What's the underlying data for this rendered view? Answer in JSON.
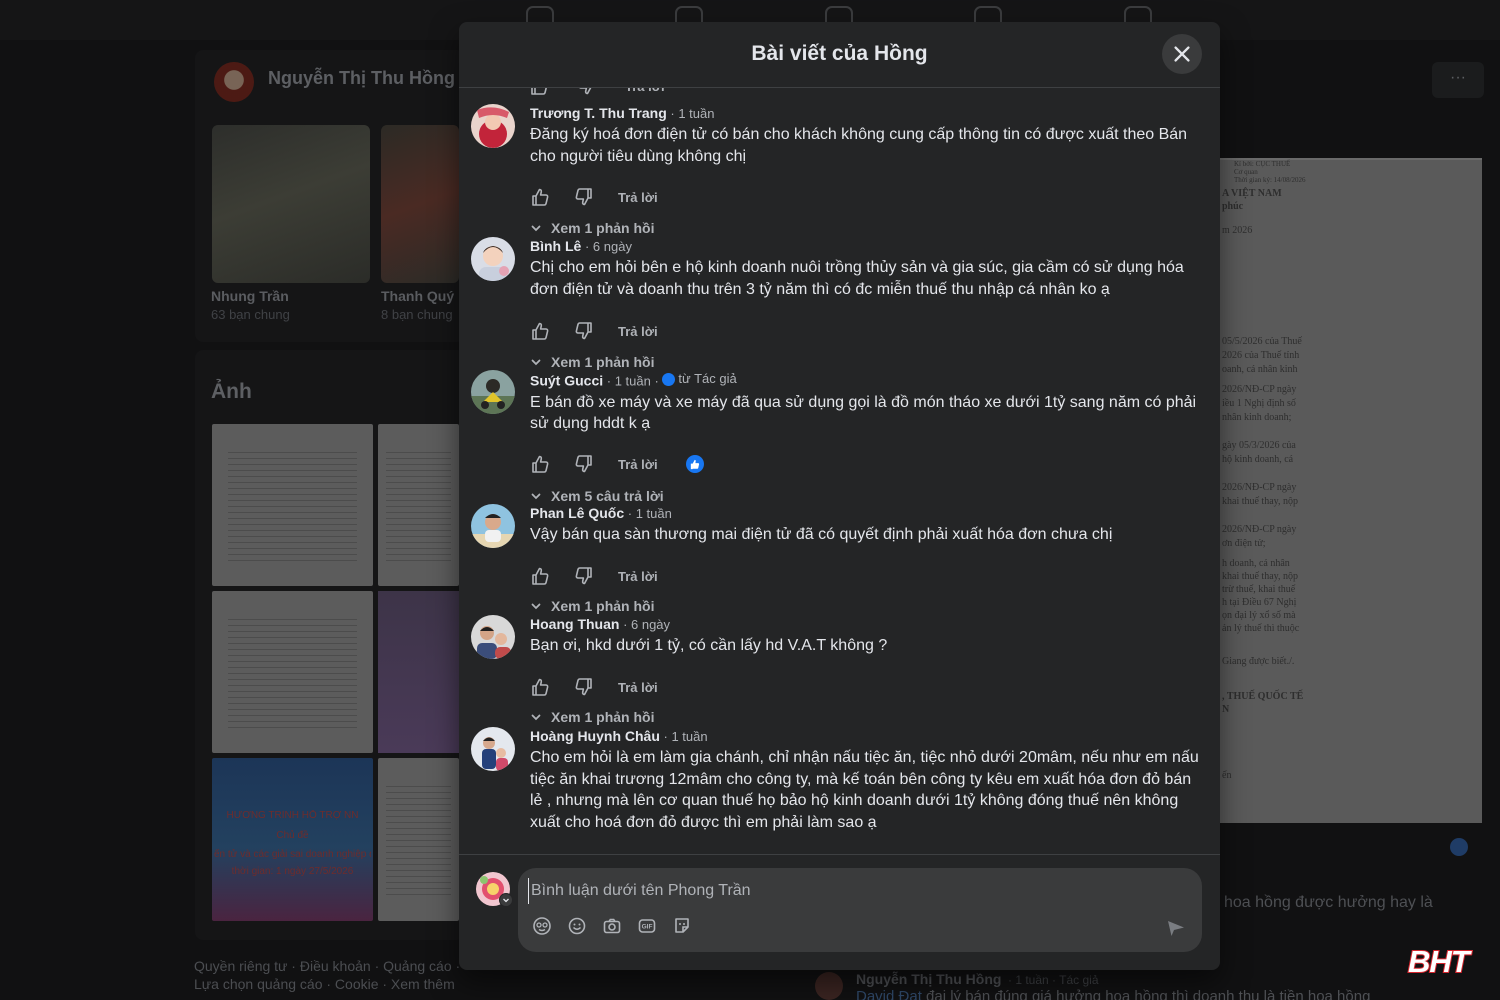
{
  "background": {
    "profile_name": "Nguyễn Thị Thu Hồng",
    "more_label": "···",
    "friends": [
      {
        "name": "Nhung Trần",
        "mutual": "63 bạn chung"
      },
      {
        "name": "Thanh Quý",
        "mutual": "8 bạn chung"
      }
    ],
    "photos_heading": "Ảnh",
    "banner_lines": [
      "HƯƠNG TRÌNH HỖ TRỢ NN",
      "Chủ đề",
      "ển tử và các giải sai doanh nghiệp đ",
      "thời gian: 1 ngày 27/5/2026"
    ],
    "right_doc_lines": [
      "Kí bởi: CỤC THUẾ",
      "Cơ quan",
      "Thời gian ký: 14/08/2026",
      "A VIỆT NAM",
      "phúc",
      "m 2026",
      "05/5/2026 của Thuế",
      "2026 của Thuế tỉnh",
      "oanh, cá nhân kinh",
      "2026/NĐ-CP ngày",
      "iều 1 Nghị định số",
      "nhân kinh doanh;",
      "gày 05/3/2026 của",
      "hộ kinh doanh, cá",
      "2026/NĐ-CP ngày",
      "khai thuế thay, nộp",
      "2026/NĐ-CP ngày",
      "ơn điện tử;",
      "h doanh, cá nhân",
      "khai thuế thay, nộp",
      "trừ thuế, khai thuế",
      "h tại Điều 67 Nghị",
      "ọn đại lý xổ số mà",
      "ản lý thuế thì thuộc",
      "Giang được biết./.",
      ", THUẾ QUỐC TẾ",
      "N",
      "ến"
    ],
    "right_text": "hoa hồng được hưởng hay là",
    "footer": "Quyền riêng tư · Điều khoản · Quảng cáo · Lựa chọn quảng cáo · Cookie · Xem thêm",
    "bottom_comment": {
      "name": "Nguyễn Thị Thu Hồng",
      "meta": "· 1 tuần · Tác giả",
      "link": "David Đạt",
      "text": " đại lý bán đúng giá hưởng hoa hồng thì doanh thu là tiền hoa hồng"
    }
  },
  "modal": {
    "title": "Bài viết của Hồng",
    "close_icon": "close-icon"
  },
  "labels": {
    "reply": "Trả lời"
  },
  "comments": [
    {
      "name": "Trương T. Thu Trang",
      "time": "· 1 tuần",
      "text": "Đăng ký hoá đơn điện tử có bán cho khách không cung cấp thông tin có được xuất theo Bán cho người tiêu dùng không chị",
      "view_replies": "Xem 1 phản hồi"
    },
    {
      "name": "Bình Lê",
      "time": "· 6 ngày",
      "text": "Chị cho em hỏi bên e hộ kinh doanh nuôi trồng thủy sản và gia súc, gia cầm có sử dụng hóa đơn điện tử và doanh thu trên 3 tỷ năm thì có đc miễn thuế thu nhập cá nhân ko ạ",
      "view_replies": "Xem 1 phản hồi"
    },
    {
      "name": "Suýt Gucci",
      "time": "· 1 tuần ·",
      "author_badge": "từ Tác giả",
      "text": "E bán đồ xe máy và xe máy đã qua sử dụng gọi là đồ món tháo xe dưới 1tỷ sang năm có phải sử dụng hddt k ạ",
      "view_replies": "Xem 5 câu trả lời"
    },
    {
      "name": "Phan Lê Quốc",
      "time": "· 1 tuần",
      "text": "Vậy bán qua sàn thương mai điện tử đã có quyết định phải xuất hóa đơn chưa chị",
      "view_replies": "Xem 1 phản hồi"
    },
    {
      "name": "Hoang Thuan",
      "time": "· 6 ngày",
      "text": "Bạn ơi, hkd dưới 1 tỷ, có cần lấy hd V.A.T không ?",
      "view_replies": "Xem 1 phản hồi"
    },
    {
      "name": "Hoàng Huynh Châu",
      "time": "· 1 tuần",
      "text": "Cho em hỏi là em làm gia chánh, chỉ nhận nấu tiệc ăn, tiệc nhỏ dưới 20mâm, nếu như em nấu tiệc ăn khai trương 12mâm cho công ty, mà kế toán bên công ty kêu em xuất hóa đơn đỏ bán lẻ , nhưng mà lên cơ quan thuế họ bảo hộ kinh doanh dưới 1tỷ không đóng thuế nên không xuất cho hoá đơn đỏ được thì em phải làm sao ạ"
    }
  ],
  "composer": {
    "placeholder": "Bình luận dưới tên Phong Trần",
    "tools": [
      "avatar-sticker-icon",
      "emoji-icon",
      "camera-icon",
      "gif-icon",
      "sticker-icon"
    ],
    "send_icon": "send-icon"
  },
  "watermark": "BHT",
  "colors": {
    "modal_bg": "#242526",
    "composer_bg": "#3a3b3c",
    "text_primary": "#e4e6eb",
    "text_secondary": "#b0b3b8",
    "accent": "#1877f2",
    "watermark_red": "#d7262e"
  }
}
